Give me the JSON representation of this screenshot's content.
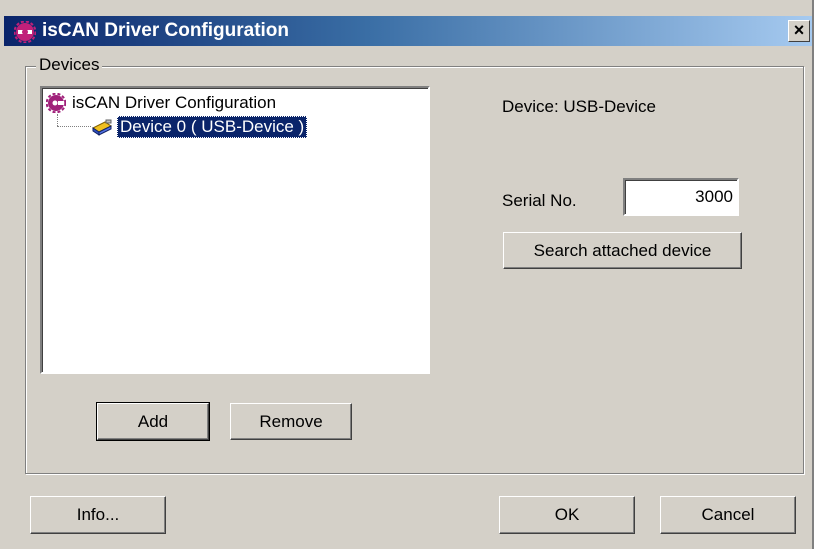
{
  "window": {
    "title": "isCAN Driver Configuration",
    "close_label": "×"
  },
  "devices_group": {
    "label": "Devices",
    "tree": {
      "root_label": "isCAN Driver Configuration",
      "child_label": "Device 0  ( USB-Device )"
    },
    "add_label": "Add",
    "remove_label": "Remove"
  },
  "device_panel": {
    "device_text": "Device: USB-Device",
    "serial_label": "Serial No.",
    "serial_value": "3000",
    "search_label": "Search attached device"
  },
  "footer": {
    "info_label": "Info...",
    "ok_label": "OK",
    "cancel_label": "Cancel"
  },
  "colors": {
    "title_gradient_start": "#0a246a",
    "title_gradient_end": "#a6caf0",
    "selection": "#0a246a",
    "face": "#d4d0c8",
    "app_icon": "#a0207a"
  },
  "icons": {
    "app": "gear-app-icon",
    "device": "usb-device-icon",
    "close": "close-icon"
  }
}
